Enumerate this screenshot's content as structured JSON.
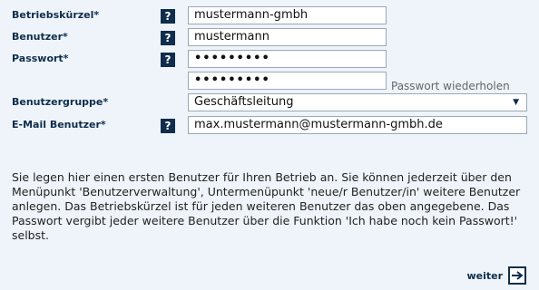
{
  "form": {
    "company_code": {
      "label": "Betriebskürzel*",
      "value": "mustermann-gmbh"
    },
    "user": {
      "label": "Benutzer*",
      "value": "mustermann"
    },
    "password": {
      "label": "Passwort*",
      "value": "•••••••••"
    },
    "password_repeat": {
      "value": "•••••••••",
      "hint": "Passwort wiederholen"
    },
    "user_group": {
      "label": "Benutzergruppe*",
      "value": "Geschäftsleitung"
    },
    "email": {
      "label": "E-Mail Benutzer*",
      "value": "max.mustermann@mustermann-gmbh.de"
    }
  },
  "help_glyph": "?",
  "info_text": "Sie legen hier einen ersten Benutzer für Ihren Betrieb an. Sie können jederzeit über den Menüpunkt 'Benutzerverwaltung', Untermenüpunkt 'neue/r Benutzer/in' weitere Benutzer anlegen. Das Betriebskürzel ist für jeden weiteren Benutzer das oben angegebene. Das Passwort vergibt jeder weitere Benutzer über die Funktion 'Ich habe noch kein Passwort!' selbst.",
  "next": {
    "label": "weiter",
    "icon": "arrow-right-icon"
  },
  "colors": {
    "panel": "#eef4fa",
    "accent": "#0f2d4c"
  }
}
